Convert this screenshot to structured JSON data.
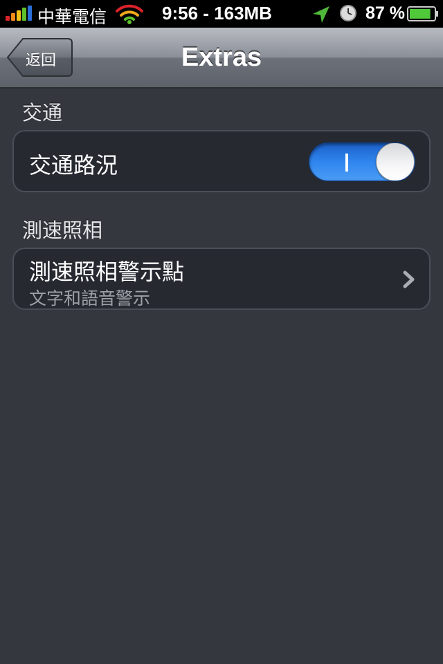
{
  "status_bar": {
    "carrier": "中華電信",
    "time": "9:56 - 163MB",
    "battery_percent": "87 %",
    "battery_level": 0.87,
    "signal_colors": [
      "#d9232a",
      "#f28a1a",
      "#f2c21a",
      "#5fbf2a",
      "#2a6fd9"
    ],
    "icons": [
      "signal-bars-icon",
      "wifi-icon",
      "location-arrow-icon",
      "clock-icon",
      "battery-icon"
    ]
  },
  "nav": {
    "back_label": "返回",
    "title": "Extras"
  },
  "sections": {
    "traffic": {
      "header": "交通",
      "row_label": "交通路況",
      "toggle_on": true
    },
    "speed_camera": {
      "header": "測速照相",
      "row_label": "測速照相警示點",
      "row_subtitle": "文字和語音警示"
    }
  },
  "colors": {
    "background": "#34373e",
    "cell_background": "#262930",
    "toggle_on": "#2f86ee"
  }
}
